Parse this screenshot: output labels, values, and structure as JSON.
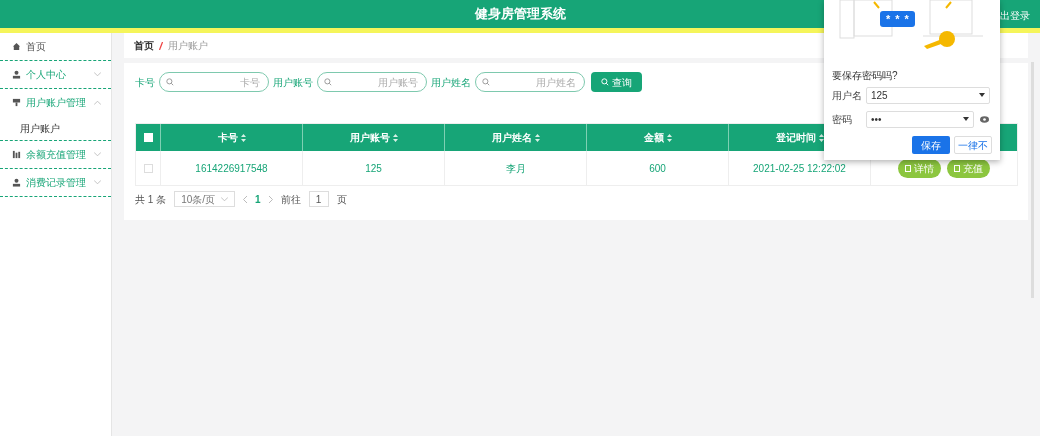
{
  "header": {
    "title": "健身房管理系统",
    "logout": "出登录"
  },
  "sidebar": {
    "items": [
      {
        "label": "首页",
        "has_caret": false
      },
      {
        "label": "个人中心",
        "expanded": false,
        "has_caret": true
      },
      {
        "label": "用户账户管理",
        "expanded": true,
        "has_caret": true,
        "children": [
          {
            "label": "用户账户"
          }
        ]
      },
      {
        "label": "余额充值管理",
        "expanded": false,
        "has_caret": true
      },
      {
        "label": "消费记录管理",
        "expanded": false,
        "has_caret": true
      }
    ]
  },
  "breadcrumb": [
    "首页",
    "用户账户"
  ],
  "search": {
    "fields": [
      {
        "label": "卡号",
        "placeholder": "卡号"
      },
      {
        "label": "用户账号",
        "placeholder": "用户账号"
      },
      {
        "label": "用户姓名",
        "placeholder": "用户姓名"
      }
    ],
    "button": "查询"
  },
  "table": {
    "select_all_checked": false,
    "columns": [
      "卡号",
      "用户账号",
      "用户姓名",
      "金额",
      "登记时间"
    ],
    "rows": [
      {
        "checked": false,
        "cells": [
          "1614226917548",
          "125",
          "李月",
          "600",
          "2021-02-25 12:22:02"
        ],
        "actions": [
          "详情",
          "充值"
        ]
      }
    ]
  },
  "pagination": {
    "total": "共 1 条",
    "page_size": "10条/页",
    "pages": [
      {
        "label": "1",
        "selected": true
      }
    ],
    "goto_label": "前往",
    "goto_value": "1",
    "goto_suffix": "页"
  },
  "password_popup": {
    "question": "要保存密码吗?",
    "username_label": "用户名",
    "username": "125",
    "password_label": "密码",
    "password": "•••",
    "masked_stars": [
      "*",
      "*",
      "*"
    ],
    "buttons": [
      "保存",
      "一律不"
    ]
  }
}
